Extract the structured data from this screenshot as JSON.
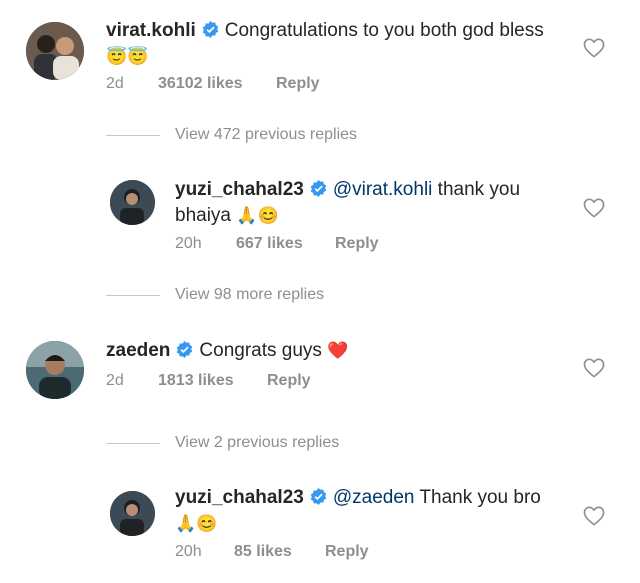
{
  "comments": [
    {
      "username": "virat.kohli",
      "text": "Congratulations to you both god bless",
      "emoji": "😇😇",
      "time": "2d",
      "likes": "36102 likes",
      "reply": "Reply"
    },
    {
      "username": "yuzi_chahal23",
      "mention": "@virat.kohli",
      "text": " thank you",
      "text2": "bhaiya ",
      "emoji": "🙏😊",
      "time": "20h",
      "likes": "667 likes",
      "reply": "Reply"
    },
    {
      "username": "zaeden",
      "text": "Congrats guys ",
      "emoji": "❤️",
      "time": "2d",
      "likes": "1813 likes",
      "reply": "Reply"
    },
    {
      "username": "yuzi_chahal23",
      "mention": "@zaeden",
      "text": " Thank you bro",
      "emoji": "🙏😊",
      "time": "20h",
      "likes": "85 likes",
      "reply": "Reply"
    }
  ],
  "view_replies": [
    "View 472 previous replies",
    "View 98 more replies",
    "View 2 previous replies"
  ],
  "colors": {
    "verified": "#3897f0",
    "mention": "#00376b",
    "meta": "#8e8e8e"
  }
}
